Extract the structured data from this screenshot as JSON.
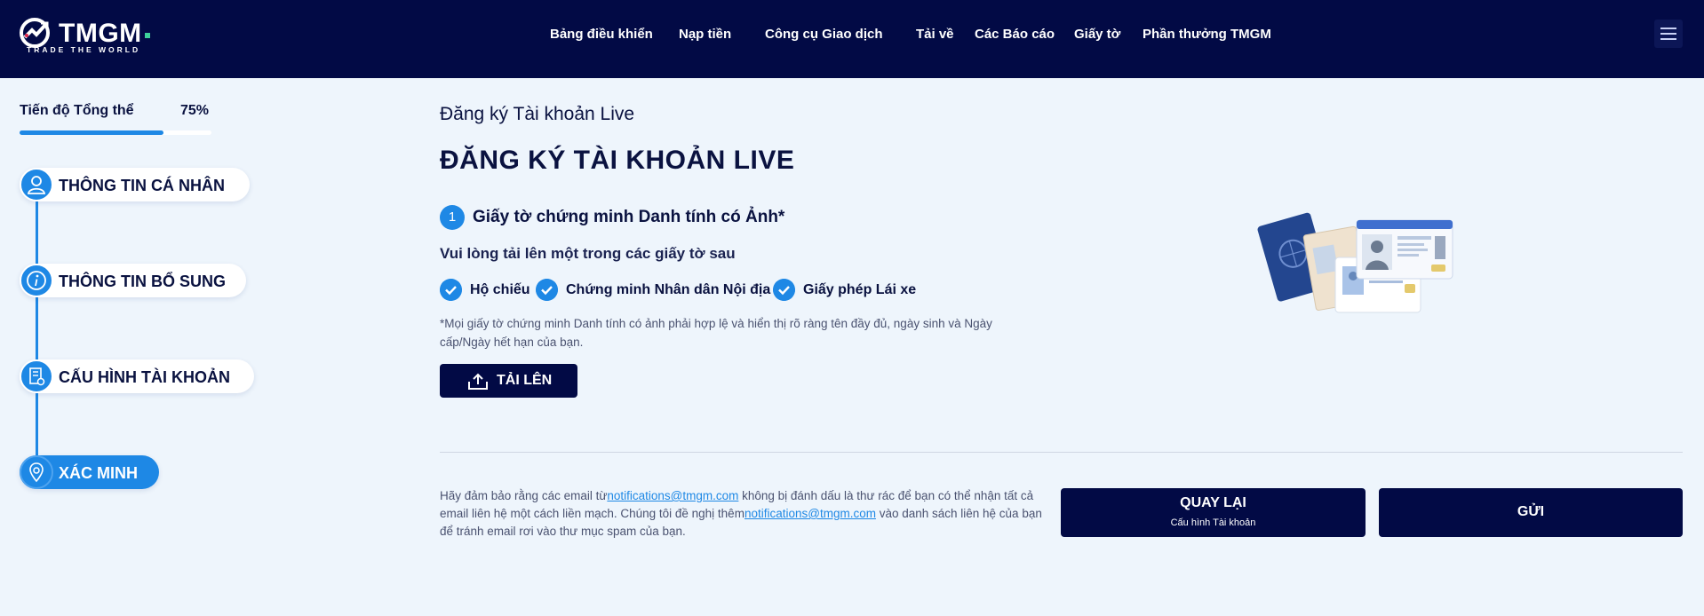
{
  "brand": {
    "name": "TMGM",
    "tagline": "TRADE THE WORLD"
  },
  "nav": {
    "items": [
      "Bảng điều khiển",
      "Nạp tiền",
      "Công cụ Giao dịch",
      "Tải về",
      "Các Báo cáo",
      "Giấy tờ",
      "Phần thưởng TMGM"
    ]
  },
  "sidebar": {
    "progress_label": "Tiến độ Tổng thể",
    "progress_value": "75%",
    "progress_fraction": 0.75,
    "steps": [
      {
        "label": "THÔNG TIN CÁ NHÂN",
        "icon": "user-icon"
      },
      {
        "label": "THÔNG TIN BỔ SUNG",
        "icon": "info-icon"
      },
      {
        "label": "CẤU HÌNH TÀI KHOẢN",
        "icon": "document-settings-icon"
      },
      {
        "label": "XÁC MINH",
        "icon": "verify-icon",
        "active": true
      }
    ]
  },
  "main": {
    "subtitle": "Đăng ký Tài khoản Live",
    "title": "ĐĂNG KÝ TÀI KHOẢN LIVE",
    "section_number": "1",
    "section_title": "Giấy tờ chứng minh Danh tính có Ảnh*",
    "instruction": "Vui lòng tải lên một trong các giấy tờ sau",
    "documents": [
      "Hộ chiếu",
      "Chứng minh Nhân dân Nội địa",
      "Giấy phép Lái xe"
    ],
    "note": "*Mọi giấy tờ chứng minh Danh tính có ảnh phải hợp lệ và hiển thị rõ ràng tên đầy đủ, ngày sinh và Ngày cấp/Ngày hết hạn của bạn.",
    "upload_label": "TẢI LÊN"
  },
  "footer": {
    "note_part1": "Hãy đảm bảo rằng các email từ",
    "email": "notifications@tmgm.com",
    "note_part2": " không bị đánh dấu là thư rác để bạn có thể nhận tất cả email liên hệ một cách liền mạch. Chúng tôi đề nghị thêm",
    "note_part3": " vào danh sách liên hệ của bạn để tránh email rơi vào thư mục spam của bạn.",
    "back_label": "QUAY LẠI",
    "back_sub": "Cấu hình Tài khoản",
    "send_label": "GỬI"
  },
  "colors": {
    "header_bg": "#020a45",
    "accent": "#1e88e5",
    "page_bg": "#eef5fc"
  }
}
